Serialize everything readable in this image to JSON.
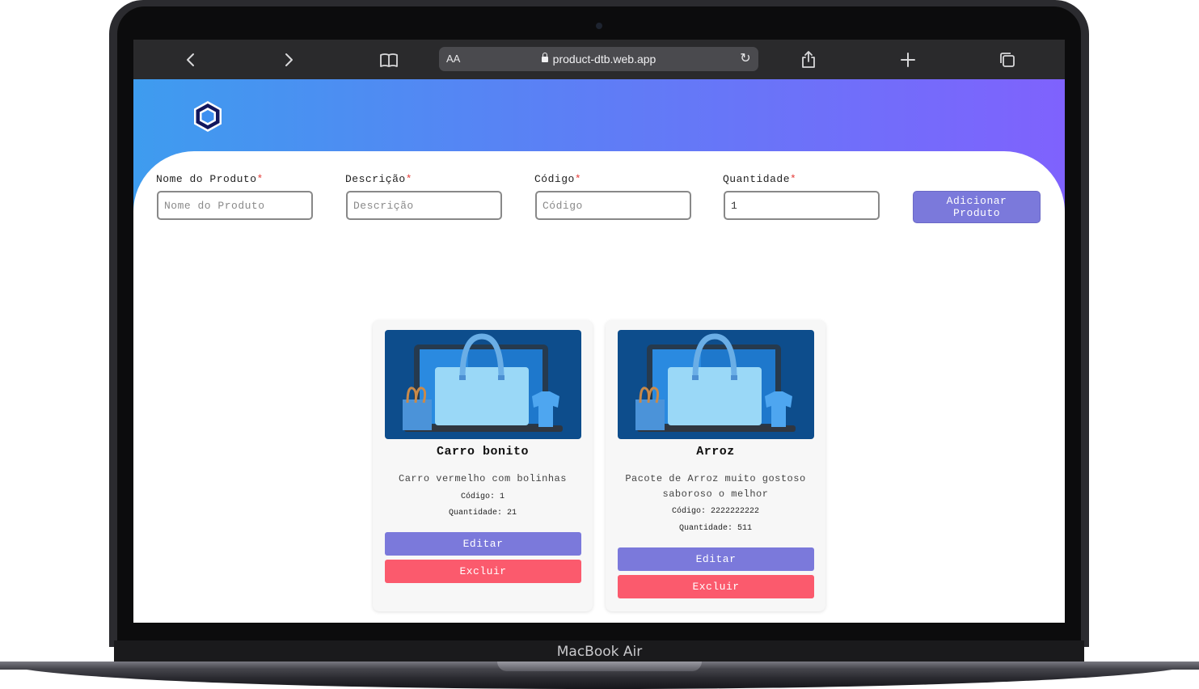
{
  "device": {
    "label": "MacBook Air"
  },
  "browser": {
    "url_prefix": "AA",
    "url": "product-dtb.web.app",
    "icons": {
      "back": "‹",
      "forward": "›",
      "bookmarks": "bookmarks-icon",
      "share": "share-icon",
      "new_tab": "+",
      "tabs": "tabs-icon",
      "reload": "↻"
    }
  },
  "colors": {
    "gradient_start": "#3e9cef",
    "gradient_end": "#7f62fd",
    "primary_button": "#7b79db",
    "delete_button": "#fb5a6d",
    "required_star": "#e53935"
  },
  "form": {
    "fields": [
      {
        "label": "Nome do Produto",
        "required": "*",
        "placeholder": "Nome do Produto",
        "value": ""
      },
      {
        "label": "Descrição",
        "required": "*",
        "placeholder": "Descrição",
        "value": ""
      },
      {
        "label": "Código",
        "required": "*",
        "placeholder": "Código",
        "value": ""
      },
      {
        "label": "Quantidade",
        "required": "*",
        "placeholder": "",
        "value": "1"
      }
    ],
    "submit_line1": "Adicionar",
    "submit_line2": "Produto"
  },
  "products": [
    {
      "title": "Carro bonito",
      "description": "Carro vermelho com bolinhas",
      "code_label": "Código:",
      "code": "1",
      "qty_label": "Quantidade:",
      "qty": "21",
      "edit_label": "Editar",
      "delete_label": "Excluir"
    },
    {
      "title": "Arroz",
      "description": "Pacote de Arroz muito gostoso saboroso o melhor",
      "code_label": "Código:",
      "code": "2222222222",
      "qty_label": "Quantidade:",
      "qty": "511",
      "edit_label": "Editar",
      "delete_label": "Excluir"
    }
  ]
}
